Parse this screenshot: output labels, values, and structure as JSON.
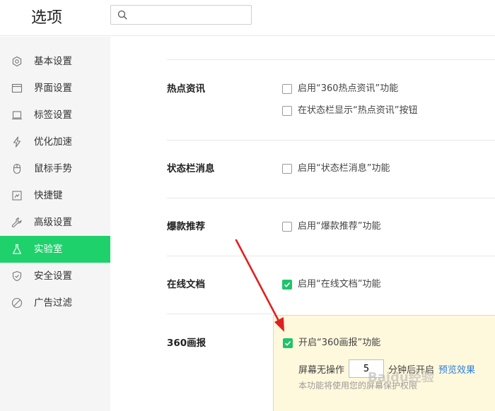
{
  "header": {
    "title": "选项",
    "search_value": "",
    "search_icon": "search-icon"
  },
  "sidebar": {
    "items": [
      {
        "label": "基本设置",
        "icon": "gear-icon",
        "active": false
      },
      {
        "label": "界面设置",
        "icon": "window-icon",
        "active": false
      },
      {
        "label": "标签设置",
        "icon": "tab-icon",
        "active": false
      },
      {
        "label": "优化加速",
        "icon": "lightning-icon",
        "active": false
      },
      {
        "label": "鼠标手势",
        "icon": "mouse-icon",
        "active": false
      },
      {
        "label": "快捷键",
        "icon": "keyboard-icon",
        "active": false
      },
      {
        "label": "高级设置",
        "icon": "wrench-icon",
        "active": false
      },
      {
        "label": "实验室",
        "icon": "flask-icon",
        "active": true
      },
      {
        "label": "安全设置",
        "icon": "shield-icon",
        "active": false
      },
      {
        "label": "广告过滤",
        "icon": "block-icon",
        "active": false
      }
    ],
    "active_color": "#1ed16b"
  },
  "main": {
    "sections": [
      {
        "title": "热点资讯",
        "options": [
          {
            "label": "启用“360热点资讯”功能",
            "checked": false
          },
          {
            "label": "在状态栏显示“热点资讯”按钮",
            "checked": false
          }
        ]
      },
      {
        "title": "状态栏消息",
        "options": [
          {
            "label": "启用“状态栏消息”功能",
            "checked": false
          }
        ]
      },
      {
        "title": "爆款推荐",
        "options": [
          {
            "label": "启用“爆款推荐”功能",
            "checked": false
          }
        ]
      },
      {
        "title": "在线文档",
        "options": [
          {
            "label": "启用“在线文档”功能",
            "checked": true
          }
        ]
      },
      {
        "title": "360画报",
        "options": [
          {
            "label": "开启“360画报”功能",
            "checked": true
          }
        ],
        "idle_prefix": "屏幕无操作",
        "idle_minutes": "5",
        "idle_suffix": "分钟后开启",
        "preview_link": "预览效果",
        "hint": "本功能将使用您的屏幕保护权限"
      }
    ],
    "check_color": "#1ec46a",
    "panel_color": "#fef8dc"
  },
  "annotation": {
    "arrow_color": "#e02020"
  },
  "watermark": "Baidu经验"
}
